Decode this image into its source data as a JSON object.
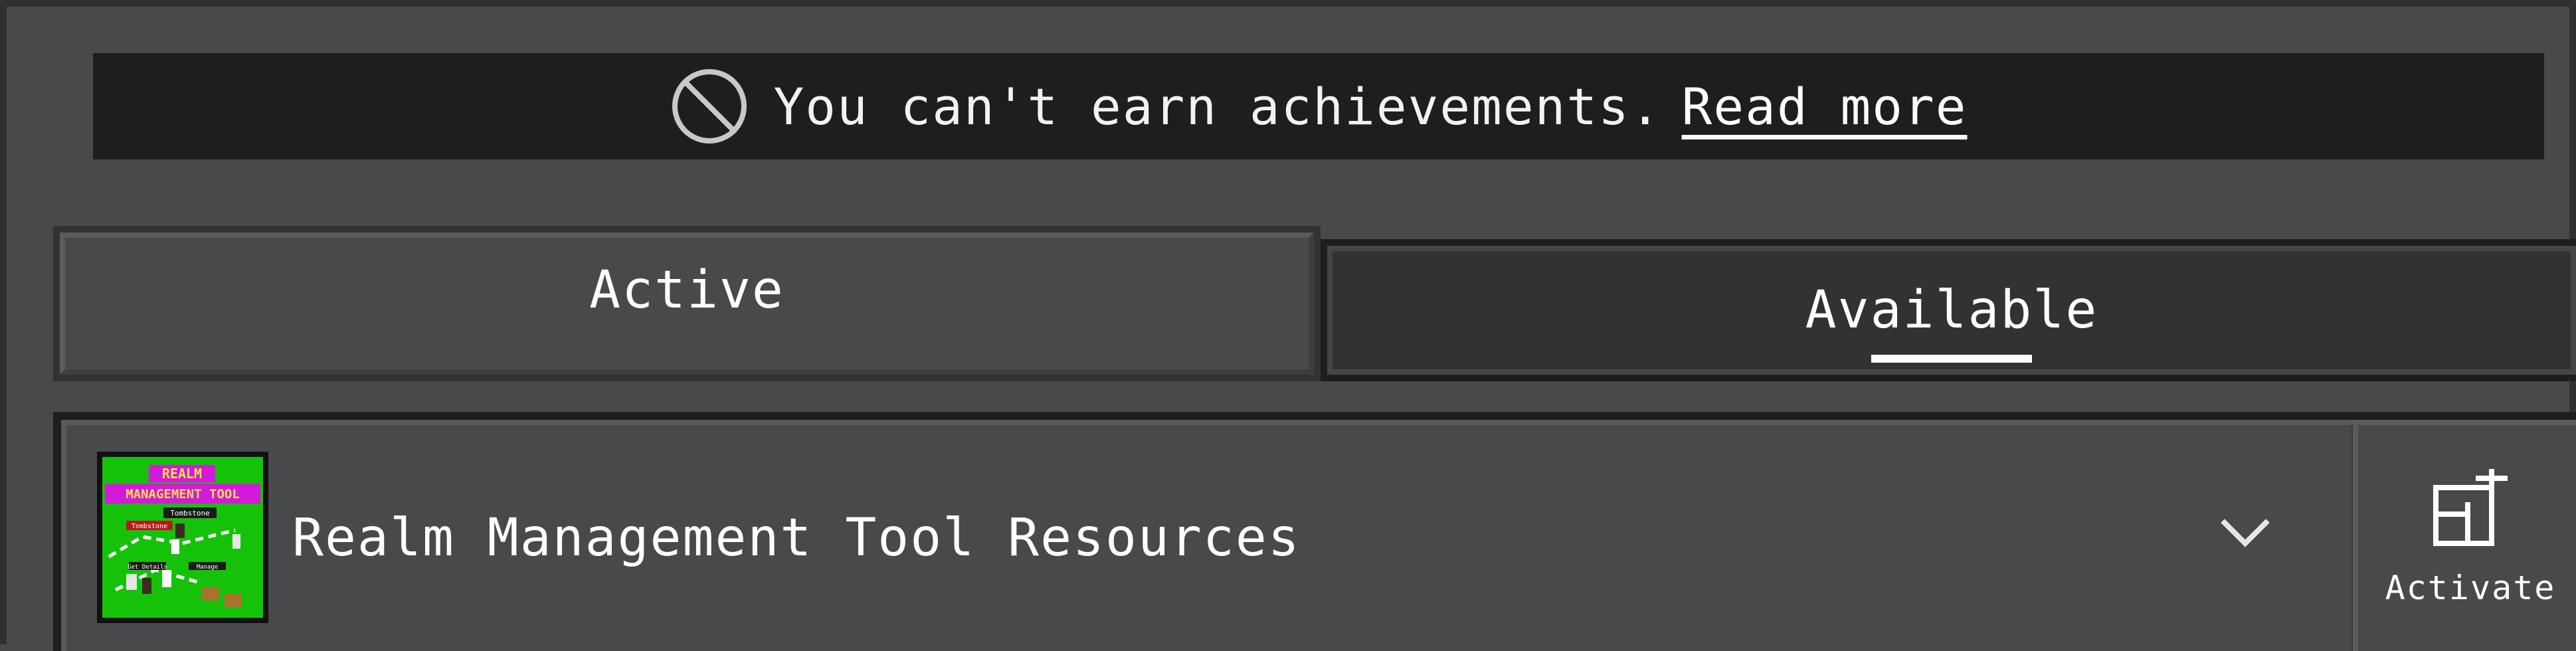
{
  "banner": {
    "message": "You can't earn achievements.",
    "link_label": "Read more"
  },
  "tabs": [
    {
      "label": "Active",
      "selected": false
    },
    {
      "label": "Available",
      "selected": true
    }
  ],
  "pack": {
    "title": "Realm Management Tool Resources",
    "thumbnail": {
      "logo_line1": "REALM",
      "logo_line2": "MANAGEMENT TOOL",
      "tag1": "Tombstone",
      "tag2": "Tombstone",
      "tag3": "Get Details",
      "tag4": "Manage"
    },
    "action_label": "Activate",
    "expand_icon": "chevron-down-icon",
    "action_icon": "add-pack-icon"
  },
  "colors": {
    "background": "#48494a",
    "banner_bg": "#1e1e1f",
    "selected_tab_bg": "#313233",
    "text": "#ffffff",
    "thumbnail_green": "#16c10a"
  }
}
